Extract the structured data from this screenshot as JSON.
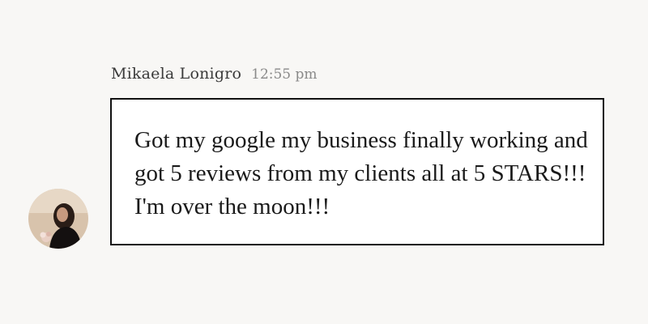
{
  "message": {
    "sender_name": "Mikaela Lonigro",
    "timestamp": "12:55 pm",
    "text": "Got my google my business finally working and got 5 reviews from my clients all at 5 STARS!!! I'm over the moon!!!",
    "avatar_icon": "user-photo-avatar"
  },
  "colors": {
    "background": "#f8f7f5",
    "bubble_border": "#111111",
    "bubble_fill": "#ffffff",
    "name_text": "#3a3a3a",
    "timestamp_text": "#8a8a8a"
  }
}
